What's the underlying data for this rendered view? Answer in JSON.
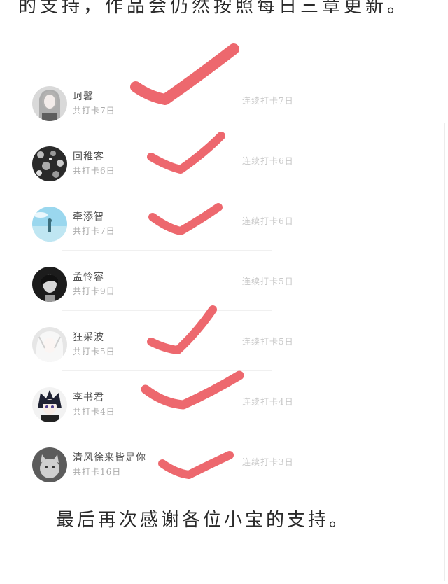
{
  "top_line": "的支持，作品会仍然按照每日三章更新。",
  "bottom_line": "最后再次感谢各位小宝的支持。",
  "accent_color": "#ec5b62",
  "rows": [
    {
      "name": "珂馨",
      "total": "共打卡7日",
      "streak": "连续打卡7日",
      "avatar": "grey-portrait-avatar",
      "checked": true
    },
    {
      "name": "回稚客",
      "total": "共打卡6日",
      "streak": "连续打卡6日",
      "avatar": "floral-pattern-avatar",
      "checked": true
    },
    {
      "name": "牵添智",
      "total": "共打卡7日",
      "streak": "连续打卡6日",
      "avatar": "sky-figure-avatar",
      "checked": true
    },
    {
      "name": "孟怜容",
      "total": "共打卡9日",
      "streak": "连续打卡5日",
      "avatar": "dark-portrait-avatar",
      "checked": false
    },
    {
      "name": "狂采波",
      "total": "共打卡5日",
      "streak": "连续打卡5日",
      "avatar": "white-hair-avatar",
      "checked": true
    },
    {
      "name": "李书君",
      "total": "共打卡4日",
      "streak": "连续打卡4日",
      "avatar": "anime-boy-avatar",
      "checked": true
    },
    {
      "name": "清风徐来皆是你",
      "total": "共打卡16日",
      "streak": "连续打卡3日",
      "avatar": "cat-avatar",
      "checked": true
    }
  ]
}
